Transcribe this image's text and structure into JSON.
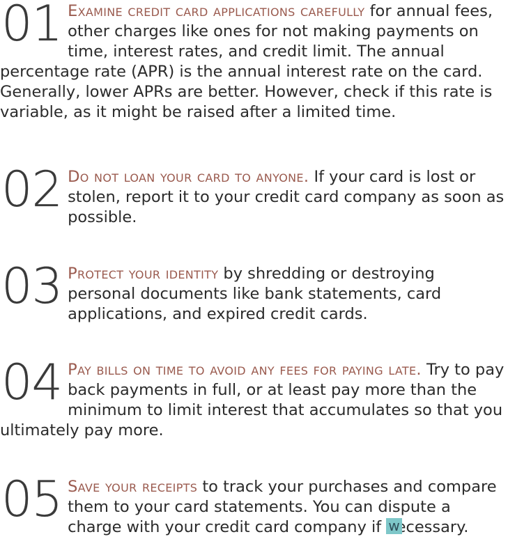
{
  "tips": [
    {
      "number": "01",
      "heading": "Examine credit card applications carefully",
      "body": " for annual fees, other charges like ones for not making payments on time, interest rates, and credit limit. The annual percentage rate (APR) is the annual interest rate on the card. Generally, lower APRs are better. However, check if this rate is variable, as it might be raised after a limited time."
    },
    {
      "number": "02",
      "heading": "Do not loan your card to anyone.",
      "body": " If your card is lost or stolen, report it to your credit card company as soon as possible."
    },
    {
      "number": "03",
      "heading": "Protect your identity",
      "body": " by shredding or destroying personal documents like bank statements, card applications, and expired credit cards."
    },
    {
      "number": "04",
      "heading": "Pay bills on time to avoid any fees for paying late.",
      "body": " Try to pay back payments in full, or at least pay more than the minimum to limit interest that accumulates so that you ultimately pay more."
    },
    {
      "number": "05",
      "heading": "Save your receipts",
      "body": " to track your purchases and compare them to your card statements. You can dispute a charge with your credit card company if necessary."
    }
  ],
  "watermark": {
    "text": "w",
    "color": "#7ec7c9"
  },
  "colors": {
    "heading": "#9a5a4e",
    "body": "#2b2b2b"
  }
}
